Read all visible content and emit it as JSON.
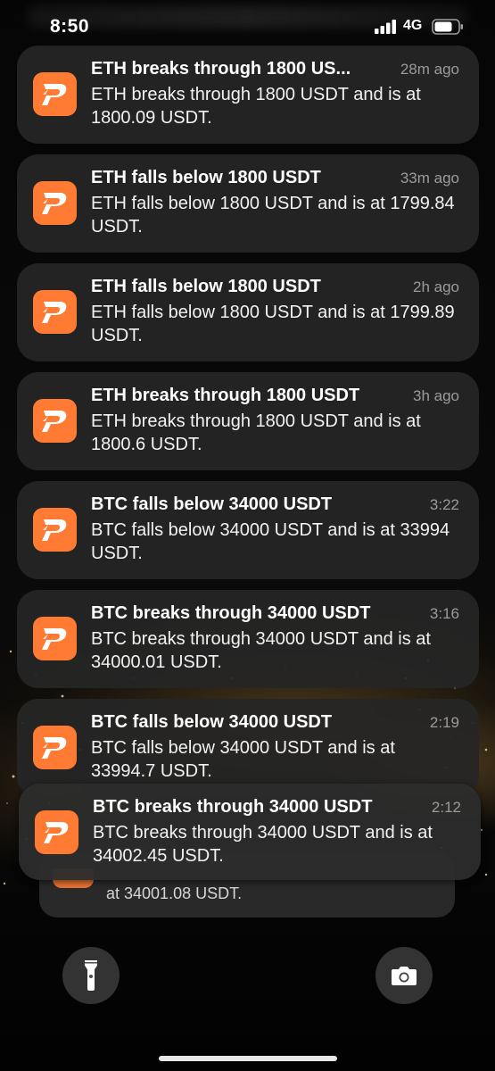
{
  "status_bar": {
    "time": "8:50",
    "network": "4G",
    "signal_icon": "cellular-signal-icon",
    "battery_icon": "battery-icon"
  },
  "app": {
    "icon": "app-logo-icon",
    "accent_color": "#ff7a33"
  },
  "notifications": [
    {
      "title": "ETH breaks through 1800 US...",
      "time": "28m ago",
      "body": "ETH breaks through 1800 USDT and is at 1800.09 USDT."
    },
    {
      "title": "ETH falls below 1800 USDT",
      "time": "33m ago",
      "body": "ETH falls below 1800 USDT and is at 1799.84 USDT."
    },
    {
      "title": "ETH falls below 1800 USDT",
      "time": "2h ago",
      "body": "ETH falls below 1800 USDT and is at 1799.89 USDT."
    },
    {
      "title": "ETH breaks through 1800 USDT",
      "time": "3h ago",
      "body": "ETH breaks through 1800 USDT and is at 1800.6 USDT."
    },
    {
      "title": "BTC falls below 34000 USDT",
      "time": "3:22",
      "body": "BTC falls below 34000 USDT and is at 33994 USDT."
    },
    {
      "title": "BTC breaks through 34000 USDT",
      "time": "3:16",
      "body": "BTC breaks through 34000 USDT and is at 34000.01 USDT."
    },
    {
      "title": "BTC falls below 34000 USDT",
      "time": "2:19",
      "body": "BTC falls below 34000 USDT and is at 33994.7 USDT."
    },
    {
      "title": "BTC breaks through 34000 USDT",
      "time": "2:12",
      "body": "BTC breaks through 34000 USDT and is at 34002.45 USDT."
    }
  ],
  "stacked_notification": {
    "body": "at 34001.08 USDT."
  },
  "controls": {
    "flashlight_icon": "flashlight-icon",
    "camera_icon": "camera-icon"
  }
}
